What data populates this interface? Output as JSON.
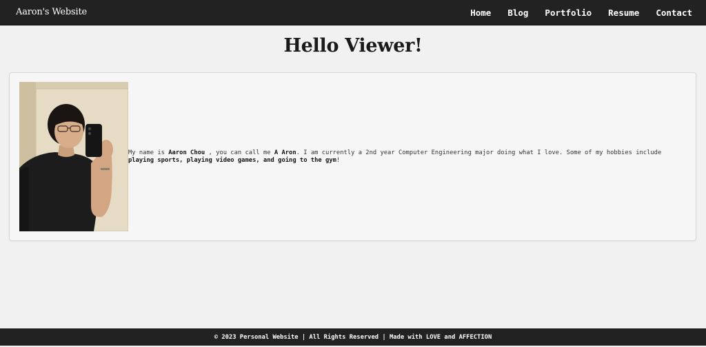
{
  "navbar": {
    "brand": "Aaron's Website",
    "links": [
      {
        "label": "Home"
      },
      {
        "label": "Blog"
      },
      {
        "label": "Portfolio"
      },
      {
        "label": "Resume"
      },
      {
        "label": "Contact"
      }
    ]
  },
  "main": {
    "title": "Hello Viewer!",
    "bio": {
      "part1": "My name is ",
      "name": "Aaron Chou ",
      "part2": ", you can call me ",
      "nickname": "A Aron",
      "part3": ". I am currently a 2nd year Computer Engineering major doing what I love. Some of my hobbies include ",
      "hobbies": "playing sports, playing video games, and going to the gym",
      "part4": "!"
    }
  },
  "footer": {
    "text": "© 2023 Personal Website | All Rights Reserved | Made with LOVE and AFFECTION"
  },
  "colors": {
    "navbar_bg": "#222222",
    "page_bg": "#f1f1f1",
    "card_bg": "#f6f6f6",
    "text_primary": "#1a1a1a"
  }
}
